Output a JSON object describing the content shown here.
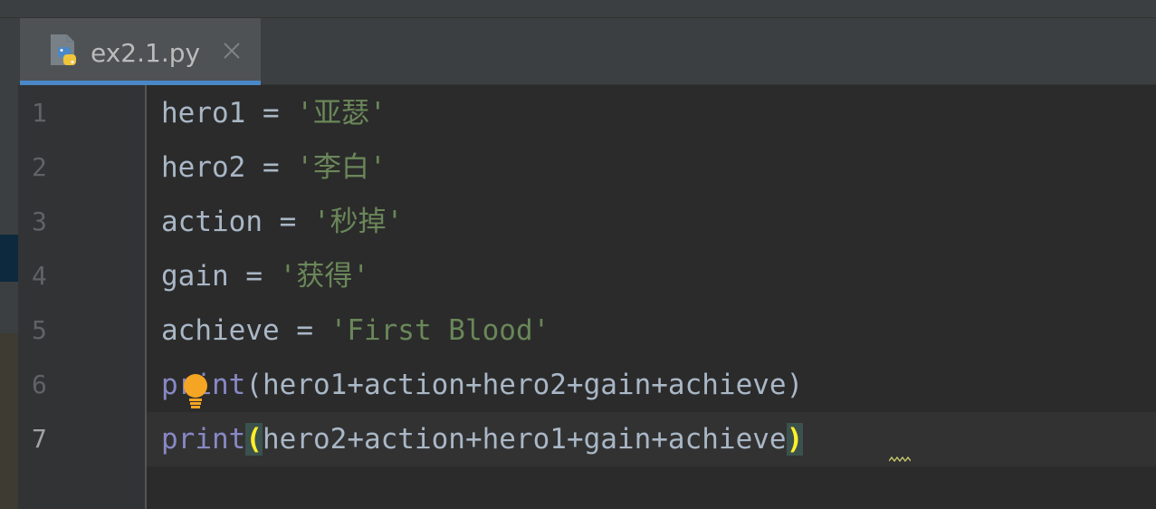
{
  "tab": {
    "filename": "ex2.1.py",
    "icon": "python-file-icon",
    "active_color": "#4a88c7"
  },
  "gutter": {
    "line_numbers": [
      "1",
      "2",
      "3",
      "4",
      "5",
      "6",
      "7"
    ],
    "current_line": "7"
  },
  "code": {
    "lines": [
      {
        "name": "hero1",
        "op": " = ",
        "str": "'亚瑟'"
      },
      {
        "name": "hero2",
        "op": " = ",
        "str": "'李白'"
      },
      {
        "name": "action",
        "op": " = ",
        "str": "'秒掉'"
      },
      {
        "name": "gain",
        "op": " = ",
        "str": "'获得'"
      },
      {
        "name": "achieve",
        "op": " = ",
        "str": "'First Blood'"
      }
    ],
    "print_line_6": {
      "fn": "print",
      "args": "(hero1+action+hero2+gain+achieve)"
    },
    "print_line_7": {
      "fn": "print",
      "open": "(",
      "args": "hero2+action+hero1+gain+achieve",
      "close": ")"
    }
  },
  "colors": {
    "background": "#2b2b2b",
    "string": "#6a8759",
    "builtin": "#8888c6",
    "identifier": "#a9b7c6",
    "bracket_match": "#ffef28"
  },
  "intention_icon": "lightbulb-icon"
}
